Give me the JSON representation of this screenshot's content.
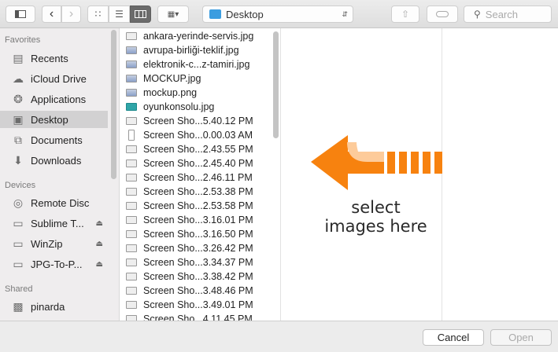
{
  "toolbar": {
    "location": "Desktop",
    "search_placeholder": "Search"
  },
  "sidebar": {
    "favorites_label": "Favorites",
    "favorites": [
      {
        "label": "Recents",
        "icon": "recents-icon"
      },
      {
        "label": "iCloud Drive",
        "icon": "cloud-icon"
      },
      {
        "label": "Applications",
        "icon": "applications-icon"
      },
      {
        "label": "Desktop",
        "icon": "desktop-icon",
        "selected": true
      },
      {
        "label": "Documents",
        "icon": "documents-icon"
      },
      {
        "label": "Downloads",
        "icon": "downloads-icon"
      }
    ],
    "devices_label": "Devices",
    "devices": [
      {
        "label": "Remote Disc",
        "icon": "disc-icon"
      },
      {
        "label": "Sublime T...",
        "icon": "drive-icon",
        "eject": true
      },
      {
        "label": "WinZip",
        "icon": "drive-icon",
        "eject": true
      },
      {
        "label": "JPG-To-P...",
        "icon": "drive-icon",
        "eject": true
      }
    ],
    "shared_label": "Shared",
    "shared": [
      {
        "label": "pinarda",
        "icon": "computer-icon"
      }
    ]
  },
  "files": [
    "ankara-yerinde-servis.jpg",
    "avrupa-birliği-teklif.jpg",
    "elektronik-c...z-tamiri.jpg",
    "MOCKUP.jpg",
    "mockup.png",
    "oyunkonsolu.jpg",
    "Screen Sho...5.40.12 PM",
    "Screen Sho...0.00.03 AM",
    "Screen Sho...2.43.55 PM",
    "Screen Sho...2.45.40 PM",
    "Screen Sho...2.46.11 PM",
    "Screen Sho...2.53.38 PM",
    "Screen Sho...2.53.58 PM",
    "Screen Sho...3.16.01 PM",
    "Screen Sho...3.16.50 PM",
    "Screen Sho...3.26.42 PM",
    "Screen Sho...3.34.37 PM",
    "Screen Sho...3.38.42 PM",
    "Screen Sho...3.48.46 PM",
    "Screen Sho...3.49.01 PM",
    "Screen Sho...4.11.45 PM"
  ],
  "overlay": {
    "line1": "select",
    "line2": "images here",
    "color": "#f7820f"
  },
  "buttons": {
    "cancel": "Cancel",
    "open": "Open"
  }
}
